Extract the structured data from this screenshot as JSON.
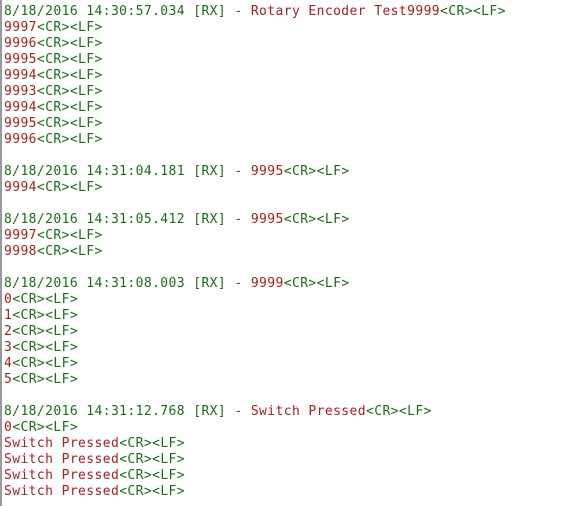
{
  "terminal": {
    "background_color": "#ffffff",
    "meta_color": "#1a6b1a",
    "data_color": "#a32020",
    "eol_color": "#1a6b1a",
    "gutter_color": "#9a9a9a",
    "eol_marker": "<CR><LF>",
    "direction_tag": "[RX]",
    "separator": "-",
    "date": "8/18/2016",
    "lines": [
      {
        "kind": "entry",
        "meta": "8/18/2016 14:30:57.034 [RX] - ",
        "data": "Rotary Encoder Test9999",
        "eol": "<CR><LF>"
      },
      {
        "kind": "data",
        "meta": "",
        "data": "9997",
        "eol": "<CR><LF>"
      },
      {
        "kind": "data",
        "meta": "",
        "data": "9996",
        "eol": "<CR><LF>"
      },
      {
        "kind": "data",
        "meta": "",
        "data": "9995",
        "eol": "<CR><LF>"
      },
      {
        "kind": "data",
        "meta": "",
        "data": "9994",
        "eol": "<CR><LF>"
      },
      {
        "kind": "data",
        "meta": "",
        "data": "9993",
        "eol": "<CR><LF>"
      },
      {
        "kind": "data",
        "meta": "",
        "data": "9994",
        "eol": "<CR><LF>"
      },
      {
        "kind": "data",
        "meta": "",
        "data": "9995",
        "eol": "<CR><LF>"
      },
      {
        "kind": "data",
        "meta": "",
        "data": "9996",
        "eol": "<CR><LF>"
      },
      {
        "kind": "blank",
        "meta": "",
        "data": "",
        "eol": ""
      },
      {
        "kind": "entry",
        "meta": "8/18/2016 14:31:04.181 [RX] - ",
        "data": "9995",
        "eol": "<CR><LF>"
      },
      {
        "kind": "data",
        "meta": "",
        "data": "9994",
        "eol": "<CR><LF>"
      },
      {
        "kind": "blank",
        "meta": "",
        "data": "",
        "eol": ""
      },
      {
        "kind": "entry",
        "meta": "8/18/2016 14:31:05.412 [RX] - ",
        "data": "9995",
        "eol": "<CR><LF>"
      },
      {
        "kind": "data",
        "meta": "",
        "data": "9997",
        "eol": "<CR><LF>"
      },
      {
        "kind": "data",
        "meta": "",
        "data": "9998",
        "eol": "<CR><LF>"
      },
      {
        "kind": "blank",
        "meta": "",
        "data": "",
        "eol": ""
      },
      {
        "kind": "entry",
        "meta": "8/18/2016 14:31:08.003 [RX] - ",
        "data": "9999",
        "eol": "<CR><LF>"
      },
      {
        "kind": "data",
        "meta": "",
        "data": "0",
        "eol": "<CR><LF>"
      },
      {
        "kind": "data",
        "meta": "",
        "data": "1",
        "eol": "<CR><LF>"
      },
      {
        "kind": "data",
        "meta": "",
        "data": "2",
        "eol": "<CR><LF>"
      },
      {
        "kind": "data",
        "meta": "",
        "data": "3",
        "eol": "<CR><LF>"
      },
      {
        "kind": "data",
        "meta": "",
        "data": "4",
        "eol": "<CR><LF>"
      },
      {
        "kind": "data",
        "meta": "",
        "data": "5",
        "eol": "<CR><LF>"
      },
      {
        "kind": "blank",
        "meta": "",
        "data": "",
        "eol": ""
      },
      {
        "kind": "entry",
        "meta": "8/18/2016 14:31:12.768 [RX] - ",
        "data": "Switch Pressed",
        "eol": "<CR><LF>"
      },
      {
        "kind": "data",
        "meta": "",
        "data": "0",
        "eol": "<CR><LF>"
      },
      {
        "kind": "data",
        "meta": "",
        "data": "Switch Pressed",
        "eol": "<CR><LF>"
      },
      {
        "kind": "data",
        "meta": "",
        "data": "Switch Pressed",
        "eol": "<CR><LF>"
      },
      {
        "kind": "data",
        "meta": "",
        "data": "Switch Pressed",
        "eol": "<CR><LF>"
      },
      {
        "kind": "data",
        "meta": "",
        "data": "Switch Pressed",
        "eol": "<CR><LF>"
      }
    ]
  }
}
